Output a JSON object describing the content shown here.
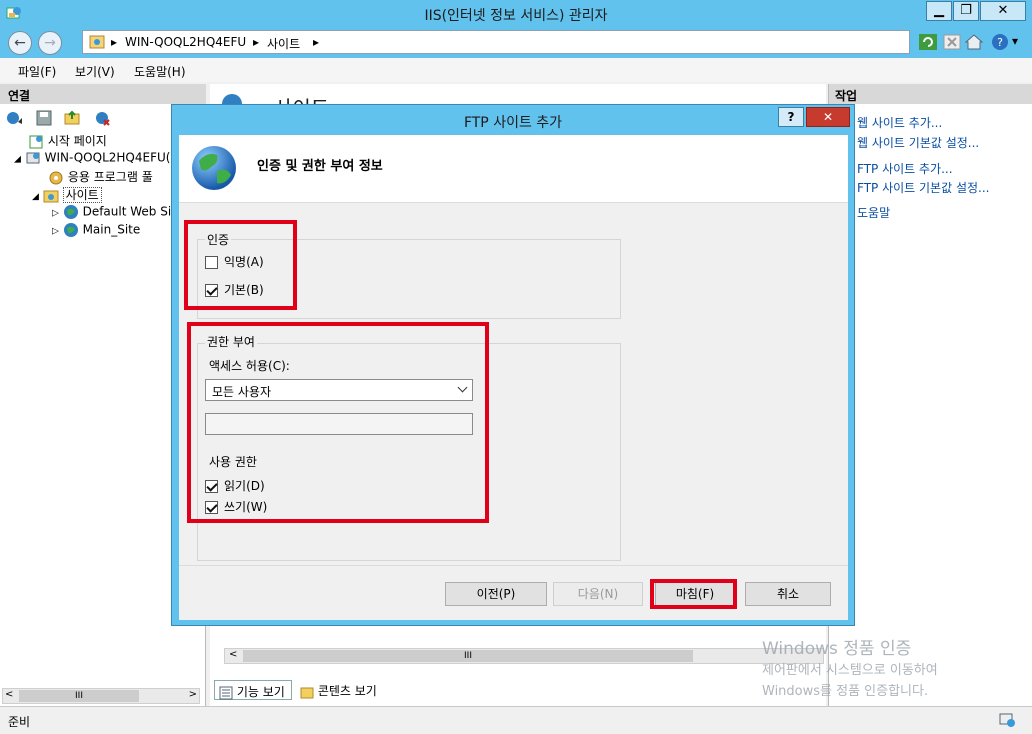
{
  "window": {
    "title": "IIS(인터넷 정보 서비스) 관리자",
    "min": "▁",
    "max": "❐",
    "close": "✕"
  },
  "address": {
    "back": "←",
    "forward": "→",
    "sep": "▸",
    "crumbs": [
      "WIN-QOQL2HQ4EFU",
      "사이트"
    ],
    "help_dropdown": "▾"
  },
  "menu": {
    "file": "파일(F)",
    "view": "보기(V)",
    "help": "도움말(H)"
  },
  "connections": {
    "header": "연결",
    "tree": [
      {
        "label": "시작 페이지"
      },
      {
        "label": "WIN-QOQL2HQ4EFU(W"
      },
      {
        "label": "응용 프로그램 풀"
      },
      {
        "label": "사이트"
      },
      {
        "label": "Default Web Sit"
      },
      {
        "label": "Main_Site"
      }
    ],
    "scroll_thumb": "III"
  },
  "center": {
    "title_partial": "사이트",
    "scroll_thumb": "III",
    "features_view": "기능 보기",
    "content_view": "콘텐츠 보기"
  },
  "actions": {
    "header": "작업",
    "links": [
      "웹 사이트 추가...",
      "웹 사이트 기본값 설정...",
      "FTP 사이트 추가...",
      "FTP 사이트 기본값 설정...",
      "도움말"
    ]
  },
  "status": {
    "text": "준비"
  },
  "watermark": {
    "line1": "Windows 정품 인증",
    "line2": "제어판에서 시스템으로 이동하여",
    "line3": "Windows를 정품 인증합니다."
  },
  "dialog": {
    "title": "FTP 사이트 추가",
    "help": "?",
    "close": "✕",
    "heading": "인증 및 권한 부여 정보",
    "auth": {
      "group_label": "인증",
      "anonymous": {
        "label": "익명(A)",
        "checked": false
      },
      "basic": {
        "label": "기본(B)",
        "checked": true
      }
    },
    "authorization": {
      "group_label": "권한 부여",
      "access_label": "액세스 허용(C):",
      "access_value": "모든 사용자",
      "text_value": "",
      "permissions_label": "사용 권한",
      "read": {
        "label": "읽기(D)",
        "checked": true
      },
      "write": {
        "label": "쓰기(W)",
        "checked": true
      }
    },
    "buttons": {
      "previous": "이전(P)",
      "next": "다음(N)",
      "finish": "마침(F)",
      "cancel": "취소"
    }
  }
}
